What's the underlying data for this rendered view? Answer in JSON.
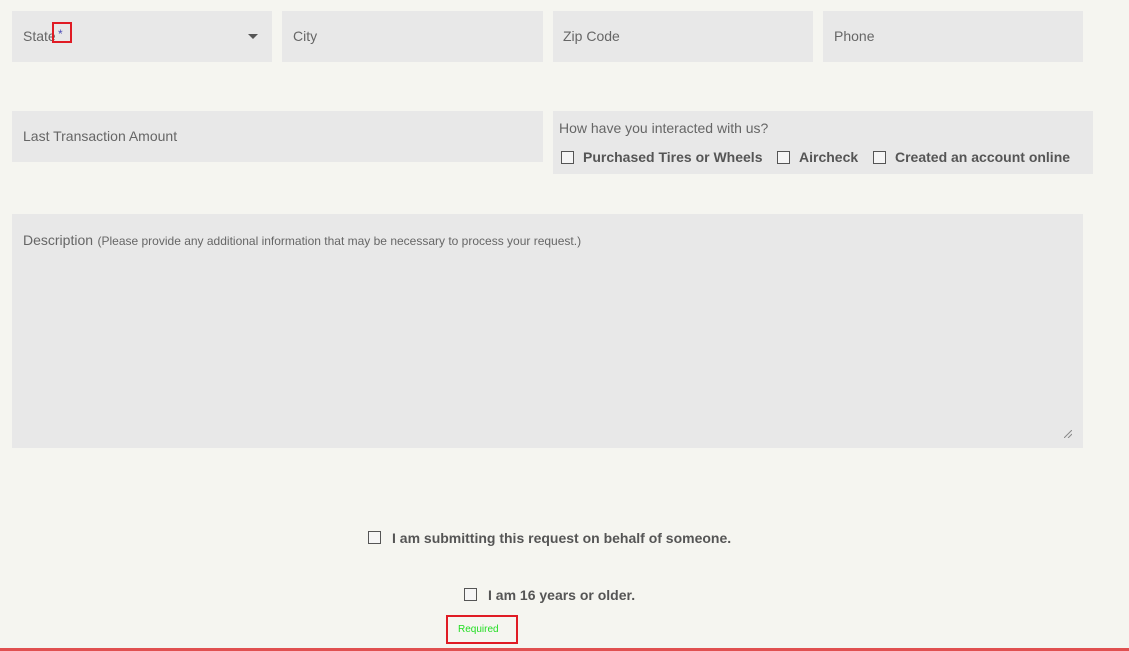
{
  "row1": {
    "state_label": "State",
    "state_required_mark": "*",
    "city_placeholder": "City",
    "zip_placeholder": "Zip Code",
    "phone_placeholder": "Phone"
  },
  "row2": {
    "last_transaction_placeholder": "Last Transaction Amount",
    "interaction_question": "How have you interacted with us?",
    "interaction_options": [
      "Purchased Tires or Wheels",
      "Aircheck",
      "Created an account online"
    ]
  },
  "description": {
    "label": "Description",
    "hint": "(Please provide any additional information that may be necessary to process your request.)"
  },
  "consent": {
    "behalf_label": "I am submitting this request on behalf of someone.",
    "age_label": "I am 16 years or older.",
    "required_text": "Required"
  },
  "colors": {
    "page_background": "#f5f5f0",
    "field_background": "#e8e8e8",
    "highlight_red": "#e01b24",
    "required_green": "#22dd22",
    "asterisk_blue": "#4a4ab8"
  }
}
